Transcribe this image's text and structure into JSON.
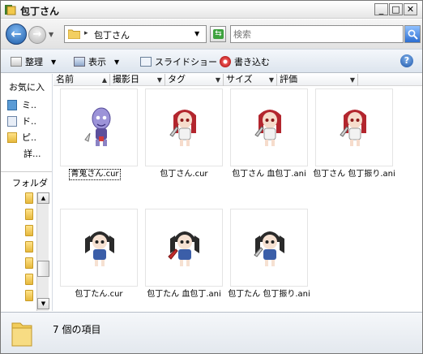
{
  "window": {
    "title": "包丁さん"
  },
  "address": {
    "path": "包丁さん",
    "separator": "▸"
  },
  "search": {
    "placeholder": "検索"
  },
  "toolbar": {
    "organize": "整理",
    "view": "表示",
    "slideshow": "スライドショー",
    "burn": "書き込む"
  },
  "leftpane": {
    "favorites_title": "お気に入",
    "items": [
      "ミ..",
      "ド..",
      "ピ..",
      "詳..."
    ],
    "folders_title": "フォルダ"
  },
  "columns": [
    "名前",
    "撮影日",
    "タグ",
    "サイズ",
    "評価"
  ],
  "files": [
    {
      "name": "青鬼さん.cur",
      "character": "blue-oni"
    },
    {
      "name": "包丁さん.cur",
      "character": "red-hair-knife"
    },
    {
      "name": "包丁さん 血包丁.ani",
      "character": "red-hair-knife"
    },
    {
      "name": "包丁さん 包丁振り.ani",
      "character": "red-hair-knife"
    },
    {
      "name": "包丁たん.cur",
      "character": "black-twintail"
    },
    {
      "name": "包丁たん 血包丁.ani",
      "character": "black-twintail"
    },
    {
      "name": "包丁たん 包丁振り.ani",
      "character": "black-twintail"
    }
  ],
  "status": {
    "item_count": "7 個の項目"
  }
}
